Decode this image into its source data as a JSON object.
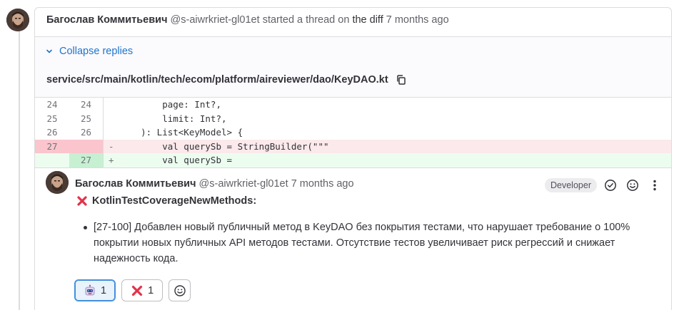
{
  "thread": {
    "author_name": "Багослав Коммитьевич",
    "author_handle": "@s-aiwrkriet-gl01et",
    "action_text": "started a thread on",
    "target_link": "the diff",
    "timestamp": "7 months ago"
  },
  "collapse": {
    "label": "Collapse replies",
    "icon": "chevron-down-icon"
  },
  "file": {
    "path": "service/src/main/kotlin/tech/ecom/platform/aireviewer/dao/KeyDAO.kt",
    "copy_icon": "copy-icon"
  },
  "diff": {
    "lines": [
      {
        "old": "24",
        "new": "24",
        "marker": "",
        "type": "context",
        "code": "        page: Int?,"
      },
      {
        "old": "25",
        "new": "25",
        "marker": "",
        "type": "context",
        "code": "        limit: Int?,"
      },
      {
        "old": "26",
        "new": "26",
        "marker": "",
        "type": "context",
        "code": "    ): List<KeyModel> {"
      },
      {
        "old": "27",
        "new": "",
        "marker": "-",
        "type": "removed",
        "code": "        val querySb = StringBuilder(\"\"\""
      },
      {
        "old": "",
        "new": "27",
        "marker": "+",
        "type": "added",
        "code": "        val querySb ="
      }
    ]
  },
  "reply": {
    "author_name": "Багослав Коммитьевич",
    "author_handle": "@s-aiwrkriet-gl01et",
    "timestamp": "7 months ago",
    "role_badge": "Developer",
    "rule_title": "KotlinTestCoverageNewMethods:",
    "bullet": "[27-100] Добавлен новый публичный метод в KeyDAO без покрытия тестами, что нарушает требование о 100% покрытии новых публичных API методов тестами. Отсутствие тестов увеличивает риск регрессий и снижает надежность кода.",
    "reactions": [
      {
        "emoji": "robot-emoji",
        "count": "1",
        "selected": true
      },
      {
        "emoji": "cross-mark-emoji",
        "count": "1",
        "selected": false
      }
    ]
  },
  "colors": {
    "link": "#1f75cb",
    "removed_bg": "#fbe9eb",
    "added_bg": "#ecfdf0",
    "border": "#dcdcde"
  }
}
